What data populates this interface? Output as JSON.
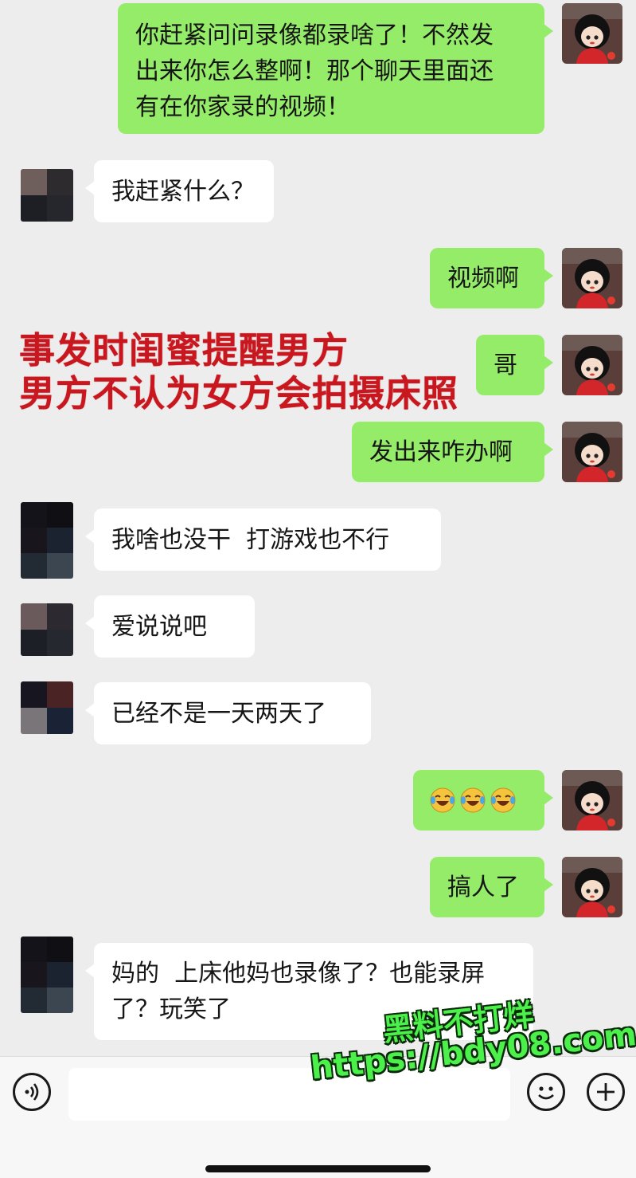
{
  "messages": [
    {
      "from": "me",
      "text": "你赶紧问问录像都录啥了！不然发\n出来你怎么整啊！那个聊天里面还\n有在你家录的视频！"
    },
    {
      "from": "other",
      "text": "我赶紧什么？"
    },
    {
      "from": "me",
      "text": "视频啊"
    },
    {
      "from": "me",
      "text": "哥"
    },
    {
      "from": "me",
      "text": "发出来咋办啊"
    },
    {
      "from": "other",
      "text": "我啥也没干  打游戏也不行"
    },
    {
      "from": "other",
      "text": "爱说说吧"
    },
    {
      "from": "other",
      "text": "已经不是一天两天了"
    },
    {
      "from": "me",
      "text": "",
      "emoji": [
        "laugh-cry-emoji",
        "laugh-cry-emoji",
        "laugh-cry-emoji"
      ]
    },
    {
      "from": "me",
      "text": "搞人了"
    },
    {
      "from": "other",
      "text": "妈的  上床他妈也录像了？也能录屏\n了？玩笑了"
    }
  ],
  "overlay_caption": {
    "line1": "事发时闺蜜提醒男方",
    "line2": "男方不认为女方会拍摄床照",
    "color": "#c8171e"
  },
  "watermark": {
    "line1": "黑料不打烊",
    "line2": "https://bdy08.com",
    "color": "#4cf04a"
  },
  "input_bar": {
    "voice_icon": "voice-icon",
    "emoji_icon": "smiley-icon",
    "plus_icon": "plus-icon"
  },
  "colors": {
    "background": "#ededed",
    "my_bubble": "#95ec69",
    "other_bubble": "#ffffff"
  }
}
